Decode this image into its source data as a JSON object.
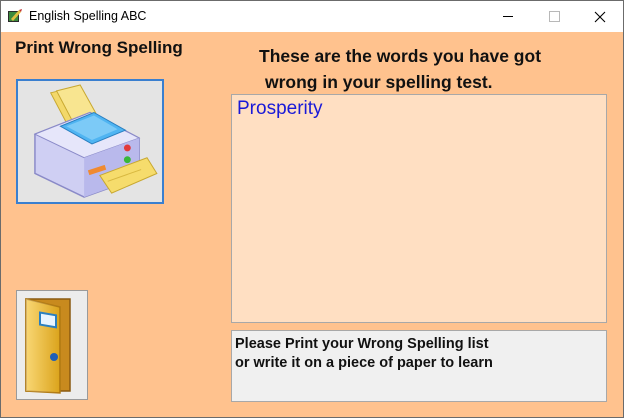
{
  "window": {
    "title": "English Spelling ABC"
  },
  "left": {
    "heading": "Print Wrong Spelling",
    "print_button_icon": "printer-icon",
    "exit_button_icon": "door-exit-icon"
  },
  "right": {
    "heading_line1": "These are the words  you have got",
    "heading_line2": "wrong in your spelling test."
  },
  "word_list": {
    "items": [
      "Prosperity"
    ]
  },
  "message": {
    "line1": "Please Print your Wrong Spelling list",
    "line2": "or write it on a piece of paper  to learn"
  },
  "colors": {
    "background": "#ffc28e",
    "list_background": "#ffdfc2",
    "word_color": "#1a1ad8",
    "selected_border": "#3a7fcf"
  }
}
